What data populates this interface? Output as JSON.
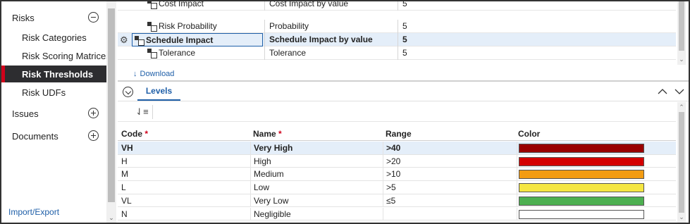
{
  "sidebar": {
    "items": [
      {
        "label": "Risks",
        "kind": "top",
        "control": "collapse"
      },
      {
        "label": "Risk Categories",
        "kind": "sub"
      },
      {
        "label": "Risk Scoring Matrices",
        "kind": "sub"
      },
      {
        "label": "Risk Thresholds",
        "kind": "sub",
        "active": true
      },
      {
        "label": "Risk UDFs",
        "kind": "sub"
      },
      {
        "label": "Issues",
        "kind": "top",
        "control": "expand"
      },
      {
        "label": "Documents",
        "kind": "top",
        "control": "expand"
      }
    ],
    "footer_link": "Import/Export"
  },
  "threshold_grid": {
    "rows": [
      {
        "name": "Cost Impact",
        "type": "Cost Impact by value",
        "levels": "5"
      },
      {
        "name": "Risk Probability",
        "type": "Probability",
        "levels": "5"
      },
      {
        "name": "Schedule Impact",
        "type": "Schedule Impact by value",
        "levels": "5",
        "selected": true
      },
      {
        "name": "Tolerance",
        "type": "Tolerance",
        "levels": "5"
      }
    ]
  },
  "download_label": "Download",
  "levels_panel": {
    "tab_label": "Levels",
    "columns": {
      "code": "Code",
      "name": "Name",
      "range": "Range",
      "color": "Color"
    },
    "required_marker": "*",
    "rows": [
      {
        "code": "VH",
        "name": "Very High",
        "range": ">40",
        "color": "#990000",
        "selected": true
      },
      {
        "code": "H",
        "name": "High",
        "range": ">20",
        "color": "#d40000"
      },
      {
        "code": "M",
        "name": "Medium",
        "range": ">10",
        "color": "#f39c12"
      },
      {
        "code": "L",
        "name": "Low",
        "range": ">5",
        "color": "#f5e642"
      },
      {
        "code": "VL",
        "name": "Very Low",
        "range": "≤5",
        "color": "#4caf50"
      },
      {
        "code": "N",
        "name": "Negligible",
        "range": "",
        "color": "#ffffff"
      }
    ]
  },
  "colors": {
    "accent": "#1f5fa8",
    "active_marker": "#d0021b",
    "active_bg": "#2d2d30",
    "selected_row": "#e4eef9"
  }
}
